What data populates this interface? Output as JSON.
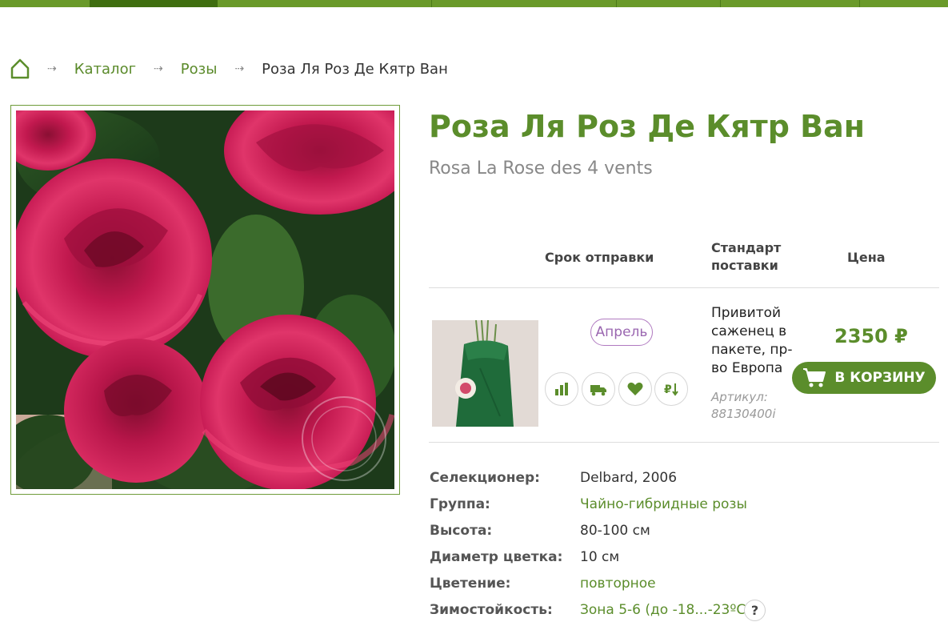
{
  "breadcrumb": {
    "items": [
      "Каталог",
      "Розы"
    ],
    "current": "Роза Ля Роз Де Кятр Ван",
    "separator": "⇢"
  },
  "product": {
    "title": "Роза Ля Роз Де Кятр Ван",
    "latin_name": "Rosa La Rose des 4 vents"
  },
  "offer_table": {
    "headers": {
      "ship": "Срок отправки",
      "standard": "Стандарт поставки",
      "price": "Цена"
    },
    "row": {
      "ship_month": "Апрель",
      "standard": "Привитой саженец в пакете, пр-во Европа",
      "sku": "Артикул: 88130400i",
      "price": "2350 ₽",
      "cart_label": "В КОРЗИНУ"
    }
  },
  "action_icons": [
    "compare-chart-icon",
    "delivery-truck-icon",
    "favorite-heart-icon",
    "price-sort-icon"
  ],
  "specs": [
    {
      "label": "Селекционер:",
      "value": "Delbard, 2006"
    },
    {
      "label": "Группа:",
      "value": "Чайно-гибридные розы"
    },
    {
      "label": "Высота:",
      "value": "80-100 см"
    },
    {
      "label": "Диаметр цветка:",
      "value": "10 см"
    },
    {
      "label": "Цветение:",
      "value": "повторное"
    },
    {
      "label": "Зимостойкость:",
      "value": "Зона 5-6 (до -18...-23ºC)"
    }
  ],
  "help_label": "?",
  "colors": {
    "brand_green": "#5b8d2b",
    "nav_dark": "#3f6e10",
    "month_badge": "#9a66b0"
  }
}
